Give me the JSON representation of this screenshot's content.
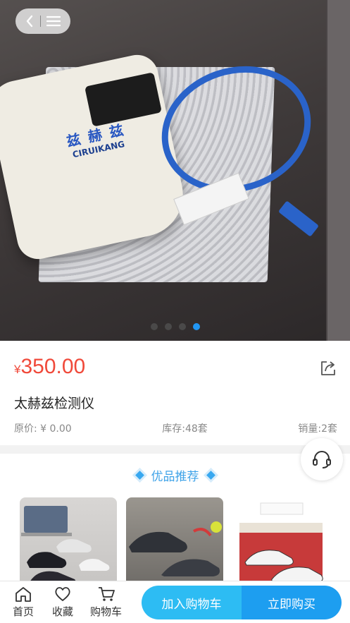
{
  "header": {
    "back_icon": "chevron-left-icon",
    "menu_icon": "menu-icon"
  },
  "gallery": {
    "image_count": 4,
    "active_index": 3
  },
  "product": {
    "price_currency": "¥",
    "price": "350.00",
    "title": "太赫兹检测仪",
    "original_price": "原价: ¥ 0.00",
    "stock": "库存:48套",
    "sales": "销量:2套"
  },
  "recommend": {
    "title": "优品推荐"
  },
  "bottom_nav": {
    "home": "首页",
    "favorite": "收藏",
    "cart": "购物车",
    "add_to_cart": "加入购物车",
    "buy_now": "立即购买"
  },
  "colors": {
    "price": "#f0493a",
    "accent": "#1d9ef0",
    "accent_light": "#2dbcf3"
  }
}
